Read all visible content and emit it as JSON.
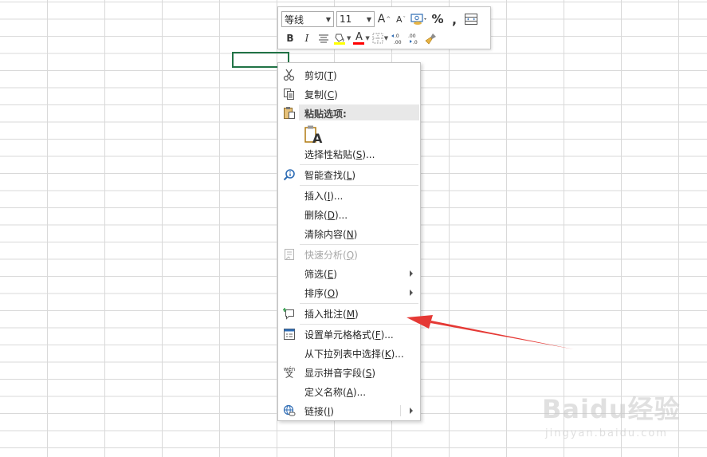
{
  "mini_toolbar": {
    "font_name": "等线",
    "font_size": "11",
    "buttons": {
      "grow_font": "A",
      "shrink_font": "A",
      "percent": "%",
      "comma": ",",
      "bold": "B",
      "italic": "I",
      "font_color": "A",
      "increase_decimal": "←.0\n.00",
      "decrease_decimal": ".00\n→.0"
    }
  },
  "context_menu": {
    "items": [
      {
        "label": "剪切(",
        "key": "T",
        "suffix": ")",
        "icon": "scissors-icon"
      },
      {
        "label": "复制(",
        "key": "C",
        "suffix": ")",
        "icon": "copy-icon"
      },
      {
        "label": "粘贴选项:",
        "icon": "clipboard-icon"
      },
      {
        "label": "选择性粘贴(",
        "key": "S",
        "suffix": ")..."
      },
      {
        "label": "智能查找(",
        "key": "L",
        "suffix": ")",
        "icon": "smart-lookup-icon"
      },
      {
        "label": "插入(",
        "key": "I",
        "suffix": ")..."
      },
      {
        "label": "删除(",
        "key": "D",
        "suffix": ")..."
      },
      {
        "label": "清除内容(",
        "key": "N",
        "suffix": ")"
      },
      {
        "label": "快速分析(",
        "key": "Q",
        "suffix": ")",
        "icon": "quick-analysis-icon",
        "disabled": true
      },
      {
        "label": "筛选(",
        "key": "E",
        "suffix": ")",
        "submenu": true
      },
      {
        "label": "排序(",
        "key": "O",
        "suffix": ")",
        "submenu": true
      },
      {
        "label": "插入批注(",
        "key": "M",
        "suffix": ")",
        "icon": "insert-comment-icon"
      },
      {
        "label": "设置单元格格式(",
        "key": "F",
        "suffix": ")...",
        "icon": "format-cells-icon"
      },
      {
        "label": "从下拉列表中选择(",
        "key": "K",
        "suffix": ")..."
      },
      {
        "label": "显示拼音字段(",
        "key": "S",
        "suffix": ")",
        "icon": "phonetic-icon"
      },
      {
        "label": "定义名称(",
        "key": "A",
        "suffix": ")..."
      },
      {
        "label": "链接(",
        "key": "I",
        "suffix": ")",
        "icon": "link-icon",
        "submenu": true
      }
    ],
    "paste_option_letter": "A"
  },
  "phonetic_glyph": {
    "top": "wén",
    "bottom": "文"
  },
  "watermark": {
    "brand": "Baidu经验",
    "url": "jingyan.baidu.com"
  },
  "colors": {
    "active_cell_border": "#217346",
    "highlight_yellow": "#ffff00",
    "font_color_red": "#ff0000",
    "arrow_red": "#e53935"
  }
}
